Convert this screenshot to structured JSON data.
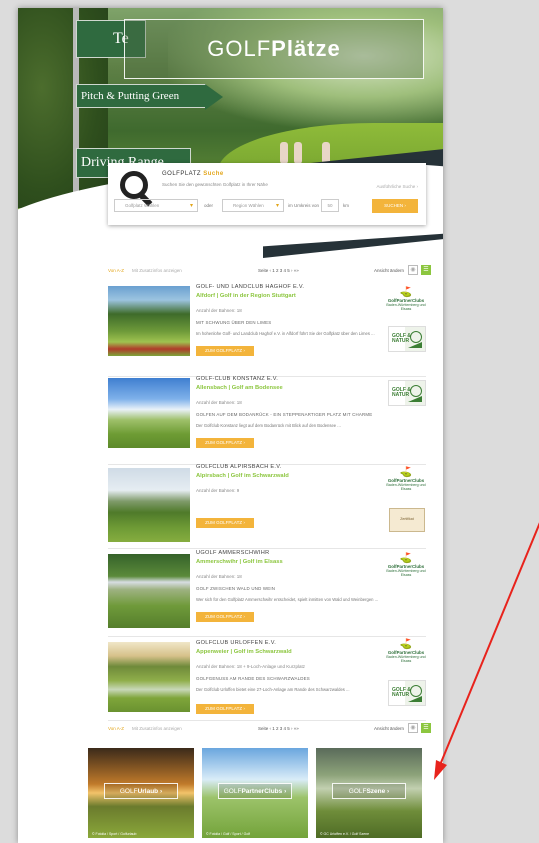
{
  "header": {
    "title_light": "GOLF",
    "title_bold": "Plätze",
    "sign_top": "Te",
    "sign_mid": "Pitch & Putting Green",
    "sign_low": "Driving Range"
  },
  "search": {
    "title_a": "GOLFPLATZ",
    "title_b": "Suche",
    "subtitle": "Suchen Sie den gewünschten Golfplatz in Ihrer Nähe",
    "right_link": "Ausführliche Suche ›",
    "select1": "Golfplatz Wählen",
    "oder": "oder",
    "select2": "Region Wählen",
    "umkreis": "im Umkreis von",
    "km_value": "50",
    "km": "km",
    "button": "SUCHEN ›"
  },
  "listbar": {
    "link1": "Von A-Z",
    "link2": "Mit Zusatzinfos anzeigen",
    "pages": "Seite ‹ 1 2 3 4 5 › »»",
    "view": "Ansicht ändern"
  },
  "clubs": [
    {
      "name": "GOLF- UND LANDCLUB HAGHOF E.V.",
      "sub": "Alfdorf | Golf in der Region Stuttgart",
      "holes": "Anzahl der Bahnen: 18",
      "tag": "MIT SCHWUNG ÜBER DEN LIMES",
      "desc": "Im hohenlohe Golf- und Landclub Haghof e.V. in Alfdorf führt Sie der Golfplatz über den Limes ...",
      "button": "ZUM GOLFPLATZ ›"
    },
    {
      "name": "GOLF-CLUB KONSTANZ E.V.",
      "sub": "Allensbach | Golf am Bodensee",
      "holes": "Anzahl der Bahnen: 18",
      "tag": "GOLFEN AUF DEM BODANRÜCK - EIN STEPPENARTIGER PLATZ MIT CHARME",
      "desc": "Der Golfclub Konstanz liegt auf dem Bodanrück mit Blick auf den Bodensee ...",
      "button": "ZUM GOLFPLATZ ›"
    },
    {
      "name": "GOLFCLUB ALPIRSBACH E.V.",
      "sub": "Alpirsbach | Golf im Schwarzwald",
      "holes": "Anzahl der Bahnen: 9",
      "tag": "",
      "desc": "",
      "button": "ZUM GOLFPLATZ ›"
    },
    {
      "name": "UGOLF AMMERSCHWIHR",
      "sub": "Ammerschwihr | Golf im Elsass",
      "holes": "Anzahl der Bahnen: 18",
      "tag": "GOLF ZWISCHEN WALD UND WEIN",
      "desc": "Wer sich für den Golfplatz Ammerschwihr entscheidet, spielt inmitten von Wald und Weinbergen ...",
      "button": "ZUM GOLFPLATZ ›"
    },
    {
      "name": "GOLFCLUB URLOFFEN E.V.",
      "sub": "Appenweier | Golf im Schwarzwald",
      "holes": "Anzahl der Bahnen: 18 + 9-Loch-Anlage und Kurzplatz",
      "tag": "GOLFGENUSS AM RANDE DES SCHWARZWALDES",
      "desc": "Der Golfclub Urloffen bietet eine 27-Loch-Anlage am Rande des Schwarzwaldes ...",
      "button": "ZUM GOLFPLATZ ›"
    }
  ],
  "badges": {
    "partner_a": "GolfPartnerClubs",
    "partner_b": "Baden-Württemberg und Elsass",
    "gn_a": "GOLF &",
    "gn_b": "NATUR",
    "cert": "Zertifikat"
  },
  "tiles": [
    {
      "light": "GOLF",
      "bold": "Urlaub ›",
      "caption": "© Fotolia / Sport / Golfurlaub"
    },
    {
      "light": "GOLF",
      "bold": "PartnerClubs ›",
      "caption": "© Fotolia / Golf / Sport / Golf"
    },
    {
      "light": "GOLF",
      "bold": "Szene ›",
      "caption": "© GC Urloffen e.V. / Golf Szene"
    }
  ],
  "colors": {
    "accent": "#f3b43b",
    "green": "#8cc63f",
    "dark": "#263238",
    "arrow": "#e8231c"
  }
}
